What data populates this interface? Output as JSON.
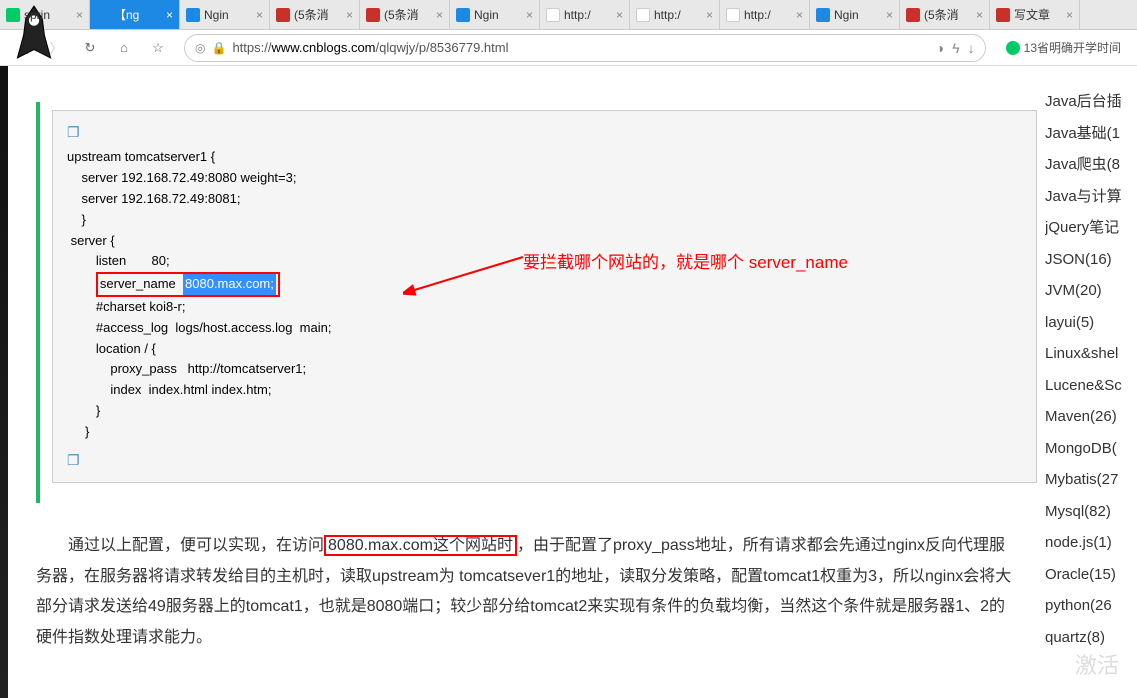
{
  "tabs": [
    {
      "title": "sprin",
      "icon": "ic-360"
    },
    {
      "title": "【ng",
      "icon": "ic-cnb",
      "active": true
    },
    {
      "title": "Ngin",
      "icon": "ic-cnb"
    },
    {
      "title": "(5条消",
      "icon": "ic-csdn"
    },
    {
      "title": "(5条消",
      "icon": "ic-csdn"
    },
    {
      "title": "Ngin",
      "icon": "ic-cnb"
    },
    {
      "title": "http:/",
      "icon": "ic-blank"
    },
    {
      "title": "http:/",
      "icon": "ic-blank"
    },
    {
      "title": "http:/",
      "icon": "ic-blank"
    },
    {
      "title": "Ngin",
      "icon": "ic-cnb"
    },
    {
      "title": "(5条消",
      "icon": "ic-csdn"
    },
    {
      "title": "写文章",
      "icon": "ic-csdn"
    }
  ],
  "url": {
    "pre": "https://",
    "host": "www.cnblogs.com",
    "path": "/qlqwjy/p/8536779.html"
  },
  "search_hint": "13省明确开学时间",
  "code": {
    "l1": "upstream tomcatserver1 {",
    "l2": "    server 192.168.72.49:8080 weight=3;",
    "l3": "    server 192.168.72.49:8081;",
    "l4": "    }",
    "l5": "",
    "l6": " server {",
    "l7": "        listen       80;",
    "l8a": "        ",
    "l8b": "server_name  ",
    "l8c": "8080.max.com;",
    "l9": "        #charset koi8-r;",
    "l10": "        #access_log  logs/host.access.log  main;",
    "l11": "        location / {",
    "l12": "            proxy_pass   http://tomcatserver1;",
    "l13": "            index  index.html index.htm;",
    "l14": "        }",
    "l15": "     }"
  },
  "annotation": "要拦截哪个网站的，就是哪个 server_name",
  "para": {
    "p1": "通过以上配置，便可以实现，在访问",
    "p1_box": "8080.max.com这个网站时",
    "p2": "，由于配置了proxy_pass地址，所有请求都会先通过nginx反向代理服务器，在服务器将请求转发给目的主机时，读取upstream为 tomcatsever1的地址，读取分发策略，配置tomcat1权重为3，所以nginx会将大部分请求发送给49服务器上的tomcat1，也就是8080端口；较少部分给tomcat2来实现有条件的负载均衡，当然这个条件就是服务器1、2的硬件指数处理请求能力。"
  },
  "cats": [
    "Java后台插",
    "Java基础(1",
    "Java爬虫(8",
    "Java与计算",
    "jQuery笔记",
    "JSON(16)",
    "JVM(20)",
    "layui(5)",
    "Linux&shel",
    "Lucene&Sc",
    "Maven(26)",
    "MongoDB(",
    "Mybatis(27",
    "Mysql(82)",
    "node.js(1)",
    "Oracle(15)",
    "python(26",
    "quartz(8)"
  ],
  "watermark": "激活"
}
